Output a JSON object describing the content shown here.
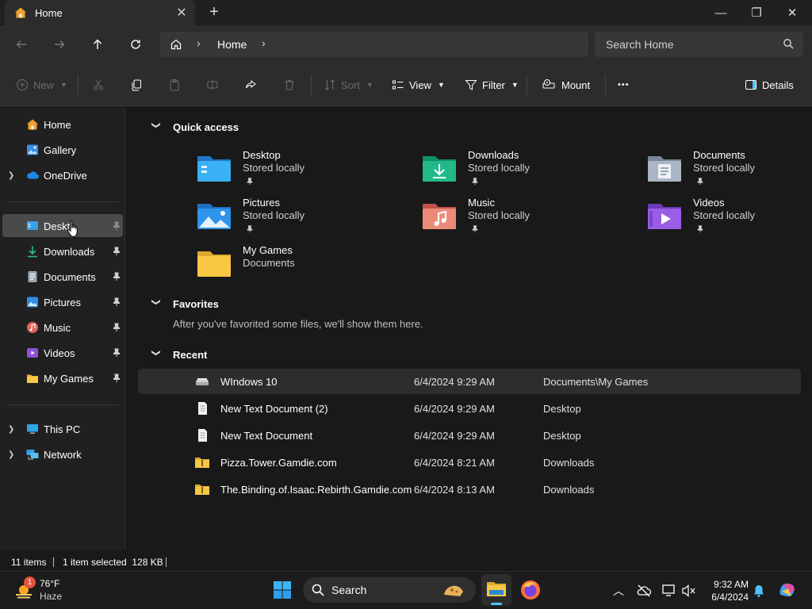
{
  "window": {
    "tab_title": "Home",
    "new_tab": "+",
    "controls": {
      "minimize": "—",
      "restore": "❐",
      "close": "✕"
    }
  },
  "address": {
    "crumbs": [
      "Home"
    ],
    "search_placeholder": "Search Home"
  },
  "toolbar": {
    "new": "New",
    "sort": "Sort",
    "view": "View",
    "filter": "Filter",
    "mount": "Mount",
    "more": "•••",
    "details": "Details"
  },
  "sidebar": {
    "home": "Home",
    "gallery": "Gallery",
    "onedrive": "OneDrive",
    "pinned": [
      {
        "label": "Desktop"
      },
      {
        "label": "Downloads"
      },
      {
        "label": "Documents"
      },
      {
        "label": "Pictures"
      },
      {
        "label": "Music"
      },
      {
        "label": "Videos"
      },
      {
        "label": "My Games"
      }
    ],
    "this_pc": "This PC",
    "network": "Network"
  },
  "quick_access": {
    "heading": "Quick access",
    "items": [
      {
        "name": "Desktop",
        "sub": "Stored locally"
      },
      {
        "name": "Downloads",
        "sub": "Stored locally"
      },
      {
        "name": "Documents",
        "sub": "Stored locally"
      },
      {
        "name": "Pictures",
        "sub": "Stored locally"
      },
      {
        "name": "Music",
        "sub": "Stored locally"
      },
      {
        "name": "Videos",
        "sub": "Stored locally"
      },
      {
        "name": "My Games",
        "sub": "Documents"
      }
    ]
  },
  "favorites": {
    "heading": "Favorites",
    "empty_message": "After you've favorited some files, we'll show them here."
  },
  "recent": {
    "heading": "Recent",
    "rows": [
      {
        "name": "WIndows 10",
        "date": "6/4/2024 9:29 AM",
        "location": "Documents\\My Games",
        "icon": "drive-icon"
      },
      {
        "name": "New Text Document (2)",
        "date": "6/4/2024 9:29 AM",
        "location": "Desktop",
        "icon": "text-file-icon"
      },
      {
        "name": "New Text Document",
        "date": "6/4/2024 9:29 AM",
        "location": "Desktop",
        "icon": "text-file-icon"
      },
      {
        "name": "Pizza.Tower.Gamdie.com",
        "date": "6/4/2024 8:21 AM",
        "location": "Downloads",
        "icon": "folder-zip-icon"
      },
      {
        "name": "The.Binding.of.Isaac.Rebirth.Gamdie.com",
        "date": "6/4/2024 8:13 AM",
        "location": "Downloads",
        "icon": "folder-zip-icon"
      }
    ]
  },
  "status": {
    "count": "11 items",
    "selection": "1 item selected  128 KB"
  },
  "taskbar": {
    "weather_temp": "76°F",
    "weather_cond": "Haze",
    "weather_badge": "1",
    "search_label": "Search",
    "time": "9:32 AM",
    "date": "6/4/2024"
  },
  "colors": {
    "accent": "#4cc2ff",
    "folder_yellow": "#f8c845",
    "selected": "#4a4a4a"
  }
}
